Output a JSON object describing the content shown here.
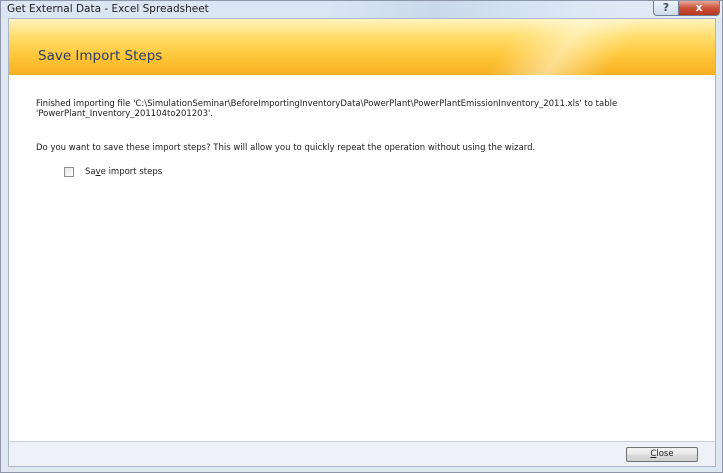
{
  "window": {
    "title": "Get External Data - Excel Spreadsheet",
    "help_glyph": "?",
    "close_glyph": "x"
  },
  "header": {
    "title": "Save Import Steps"
  },
  "main": {
    "finished_line_1": "Finished importing file 'C:\\SimulationSeminar\\BeforeImportingInventoryData\\PowerPlant\\PowerPlantEmissionInventory_2011.xls' to table",
    "finished_line_2": "'PowerPlant_Inventory_201104to201203'.",
    "question": "Do you want to save these import steps? This will allow you to quickly repeat the operation without using the wizard.",
    "save_steps": {
      "label_before": "Sa",
      "label_accel": "v",
      "label_after": "e import steps",
      "checked": false
    }
  },
  "footer": {
    "close_accel": "C",
    "close_rest": "lose"
  },
  "icons": {
    "help": "help-icon",
    "close": "close-icon"
  }
}
